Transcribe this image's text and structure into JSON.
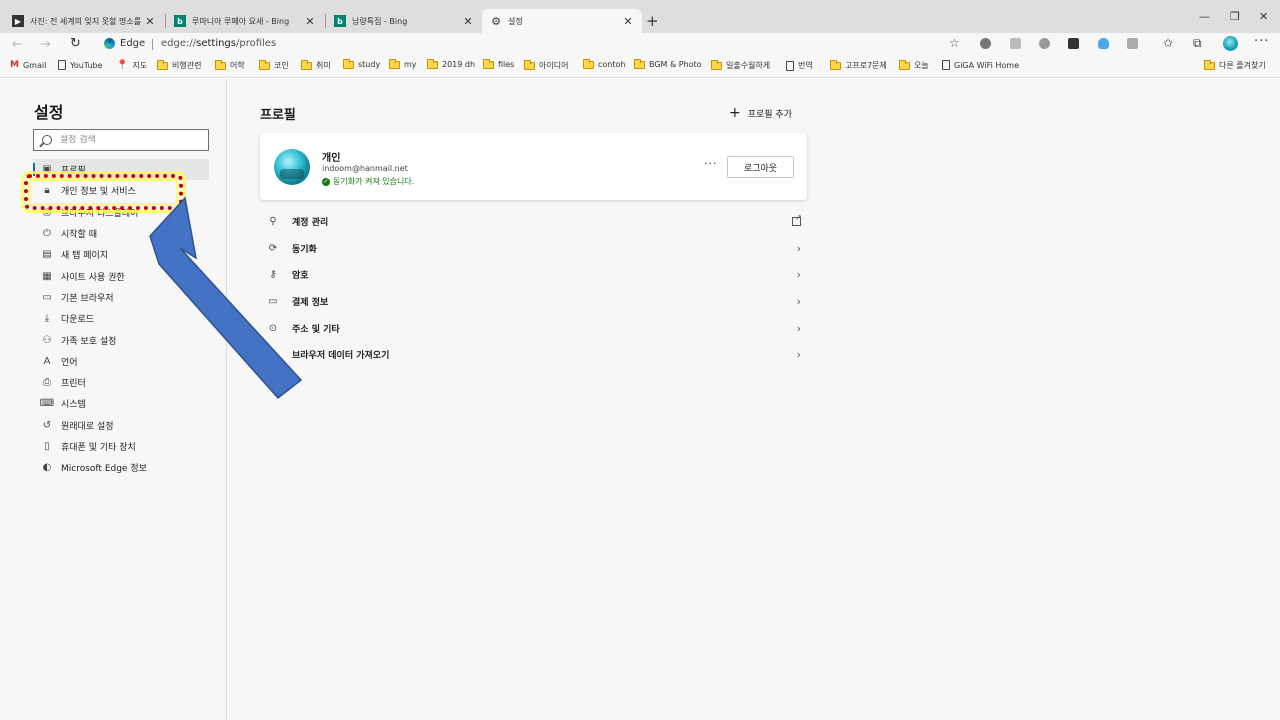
{
  "tabs": [
    {
      "title": "사진: 전 세계의 잊지 못할 명소를",
      "favicon": "photo-icon",
      "active": false
    },
    {
      "title": "루마니아 루페아 요새 - Bing",
      "favicon": "bing-icon",
      "active": false
    },
    {
      "title": "남량특집 - Bing",
      "favicon": "bing-icon",
      "active": false
    },
    {
      "title": "설정",
      "favicon": "gear-icon",
      "active": true
    }
  ],
  "window_controls": {
    "minimize": "—",
    "restore": "❐",
    "close": "✕"
  },
  "address": {
    "badge": "Edge",
    "url_scheme": "edge://",
    "url_host": "settings",
    "url_path": "/profiles"
  },
  "bookmarks": [
    {
      "label": "Gmail",
      "icon": "gmail-icon"
    },
    {
      "label": "YouTube",
      "icon": "page-icon"
    },
    {
      "label": "지도",
      "icon": "map-pin-icon"
    },
    {
      "label": "비행관련",
      "icon": "folder-icon"
    },
    {
      "label": "어학",
      "icon": "folder-icon"
    },
    {
      "label": "코인",
      "icon": "folder-icon"
    },
    {
      "label": "취미",
      "icon": "folder-icon"
    },
    {
      "label": "study",
      "icon": "folder-icon"
    },
    {
      "label": "my",
      "icon": "folder-icon"
    },
    {
      "label": "2019 dh",
      "icon": "folder-icon"
    },
    {
      "label": "files",
      "icon": "folder-icon"
    },
    {
      "label": "아이디어",
      "icon": "folder-icon"
    },
    {
      "label": "contoh",
      "icon": "folder-icon"
    },
    {
      "label": "BGM & Photo",
      "icon": "folder-icon"
    },
    {
      "label": "일출수월하게",
      "icon": "folder-icon"
    },
    {
      "label": "번역",
      "icon": "page-icon"
    },
    {
      "label": "고프로7문제",
      "icon": "folder-icon"
    },
    {
      "label": "오늘",
      "icon": "folder-icon"
    },
    {
      "label": "GiGA WiFi Home",
      "icon": "page-icon"
    },
    {
      "label": "다른 즐겨찾기",
      "icon": "folder-icon"
    }
  ],
  "sidebar": {
    "title": "설정",
    "search_placeholder": "설정 검색",
    "items": [
      {
        "label": "프로필",
        "icon": "profile-icon",
        "selected": true
      },
      {
        "label": "개인 정보 및 서비스",
        "icon": "lock-icon",
        "selected": false
      },
      {
        "label": "브라우저 디스플레이",
        "icon": "palette-icon",
        "selected": false
      },
      {
        "label": "시작할 때",
        "icon": "power-icon",
        "selected": false
      },
      {
        "label": "새 탭 페이지",
        "icon": "newtab-icon",
        "selected": false
      },
      {
        "label": "사이트 사용 권한",
        "icon": "permissions-icon",
        "selected": false
      },
      {
        "label": "기본 브라우저",
        "icon": "browser-icon",
        "selected": false
      },
      {
        "label": "다운로드",
        "icon": "download-icon",
        "selected": false
      },
      {
        "label": "가족 보호 설정",
        "icon": "family-icon",
        "selected": false
      },
      {
        "label": "언어",
        "icon": "language-icon",
        "selected": false
      },
      {
        "label": "프린터",
        "icon": "printer-icon",
        "selected": false
      },
      {
        "label": "시스템",
        "icon": "system-icon",
        "selected": false
      },
      {
        "label": "원래대로 설정",
        "icon": "reset-icon",
        "selected": false
      },
      {
        "label": "휴대폰 및 기타 장치",
        "icon": "phone-icon",
        "selected": false
      },
      {
        "label": "Microsoft Edge 정보",
        "icon": "edge-icon",
        "selected": false
      }
    ]
  },
  "main": {
    "title": "프로필",
    "add_profile": "프로필 추가",
    "profile": {
      "name": "개인",
      "email": "indoom@hanmail.net",
      "sync_status": "동기화가 켜져 있습니다.",
      "more": "···",
      "logout": "로그아웃"
    },
    "rows": [
      {
        "label": "계정 관리",
        "icon": "person-icon",
        "trail": "external-link-icon"
      },
      {
        "label": "동기화",
        "icon": "sync-icon",
        "trail": "chevron-right-icon"
      },
      {
        "label": "암호",
        "icon": "key-icon",
        "trail": "chevron-right-icon"
      },
      {
        "label": "결제 정보",
        "icon": "card-icon",
        "trail": "chevron-right-icon"
      },
      {
        "label": "주소 및 기타",
        "icon": "location-icon",
        "trail": "chevron-right-icon"
      },
      {
        "label": "브라우저 데이터 가져오기",
        "icon": "import-icon",
        "trail": "chevron-right-icon"
      }
    ]
  },
  "colors": {
    "accent": "#0f6cbd",
    "sync_green": "#107c10",
    "highlight_border": "#cc0000",
    "highlight_glow": "#ffff50",
    "arrow_fill": "#4472c4",
    "arrow_stroke": "#2f528f"
  }
}
